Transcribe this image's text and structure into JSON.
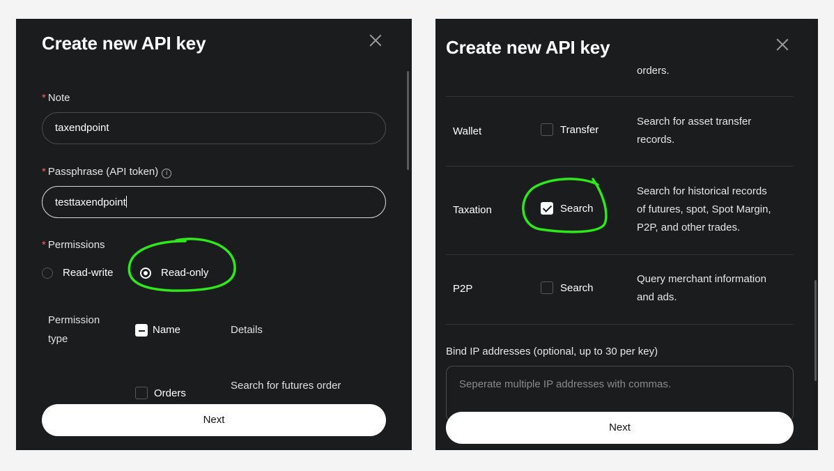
{
  "left_panel": {
    "title": "Create new API key",
    "note": {
      "label": "Note",
      "value": "taxendpoint"
    },
    "passphrase": {
      "label": "Passphrase (API token)",
      "info_icon": "info-icon",
      "value": "testtaxendpoint"
    },
    "permissions": {
      "label": "Permissions",
      "options": [
        {
          "label": "Read-write",
          "selected": false
        },
        {
          "label": "Read-only",
          "selected": true
        }
      ]
    },
    "table_header": {
      "type_line1": "Permission",
      "type_line2": "type",
      "name": "Name",
      "details": "Details"
    },
    "partial_row": {
      "name": "Orders",
      "details": "Search for futures order"
    },
    "next_label": "Next"
  },
  "right_panel": {
    "title": "Create new API key",
    "top_partial_desc": "orders.",
    "rows": [
      {
        "type": "Wallet",
        "name": "Transfer",
        "checked": false,
        "desc_line1": "Search for asset transfer",
        "desc_line2": "records."
      },
      {
        "type": "Taxation",
        "name": "Search",
        "checked": true,
        "desc_line1": "Search for historical records",
        "desc_line2": "of futures, spot, Spot Margin,",
        "desc_line3": "P2P, and other trades."
      },
      {
        "type": "P2P",
        "name": "Search",
        "checked": false,
        "desc_line1": "Query merchant information",
        "desc_line2": "and ads."
      }
    ],
    "ip": {
      "label": "Bind IP addresses (optional, up to 30 per key)",
      "placeholder": "Seperate multiple IP addresses with commas."
    },
    "next_label": "Next"
  },
  "colors": {
    "panel_bg": "#1b1c1d",
    "annotation_green": "#2ee81c",
    "button_bg": "#ffffff",
    "required_star": "#ff5c5c"
  }
}
